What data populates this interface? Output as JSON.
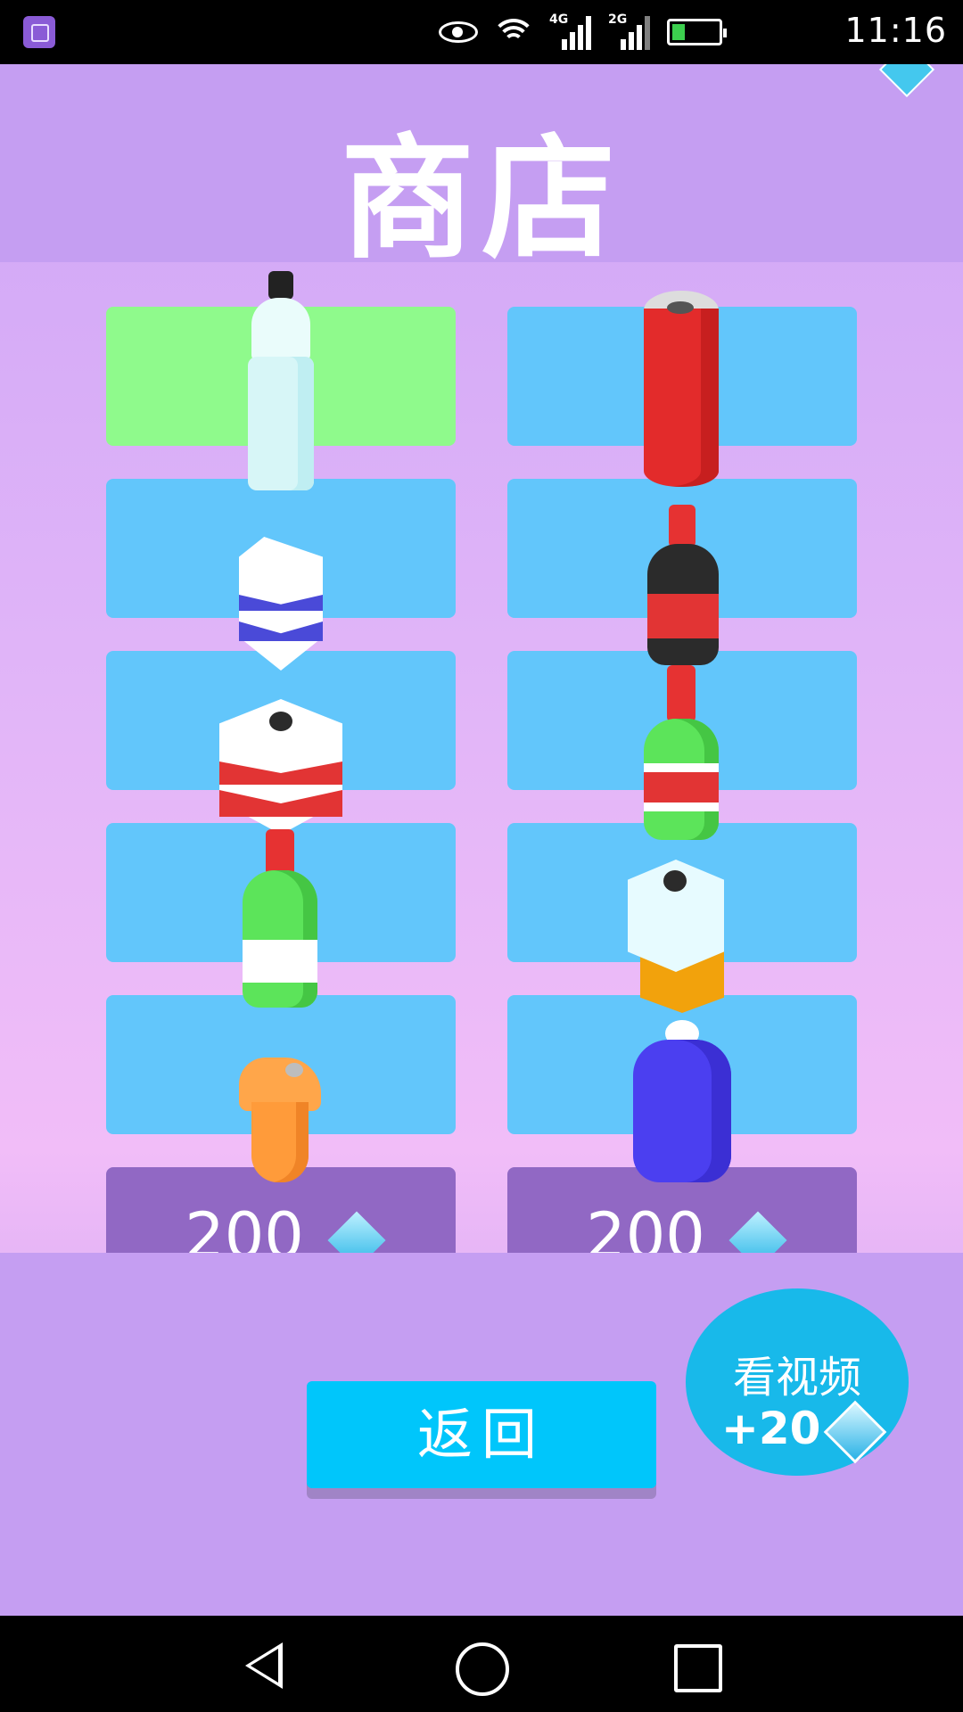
{
  "status_bar": {
    "network_1": "4G",
    "network_2": "2G",
    "time": "11:16"
  },
  "header": {
    "title": "商店"
  },
  "shop": {
    "items": [
      {
        "name": "clear-water-bottle",
        "state": "selected"
      },
      {
        "name": "red-soda-can",
        "state": "owned"
      },
      {
        "name": "milk-carton-blue",
        "state": "owned"
      },
      {
        "name": "dark-red-bottle",
        "state": "owned"
      },
      {
        "name": "jug-red-stripe",
        "state": "owned"
      },
      {
        "name": "green-bottle-red-stripe",
        "state": "owned"
      },
      {
        "name": "green-bottle-white-label",
        "state": "owned"
      },
      {
        "name": "cyan-orange-jug",
        "state": "owned"
      },
      {
        "name": "orange-cup",
        "state": "owned"
      },
      {
        "name": "blue-water-jug",
        "state": "owned"
      }
    ],
    "locked": [
      {
        "price": "200"
      },
      {
        "price": "200"
      }
    ]
  },
  "buttons": {
    "back": "返回",
    "video_label": "看视频",
    "video_reward": "+20"
  },
  "colors": {
    "tile": "#62c6fb",
    "selected_tile": "#8ffa8c",
    "locked_tile": "#9168c4",
    "header": "#c59ef2",
    "button": "#00c6fb"
  }
}
